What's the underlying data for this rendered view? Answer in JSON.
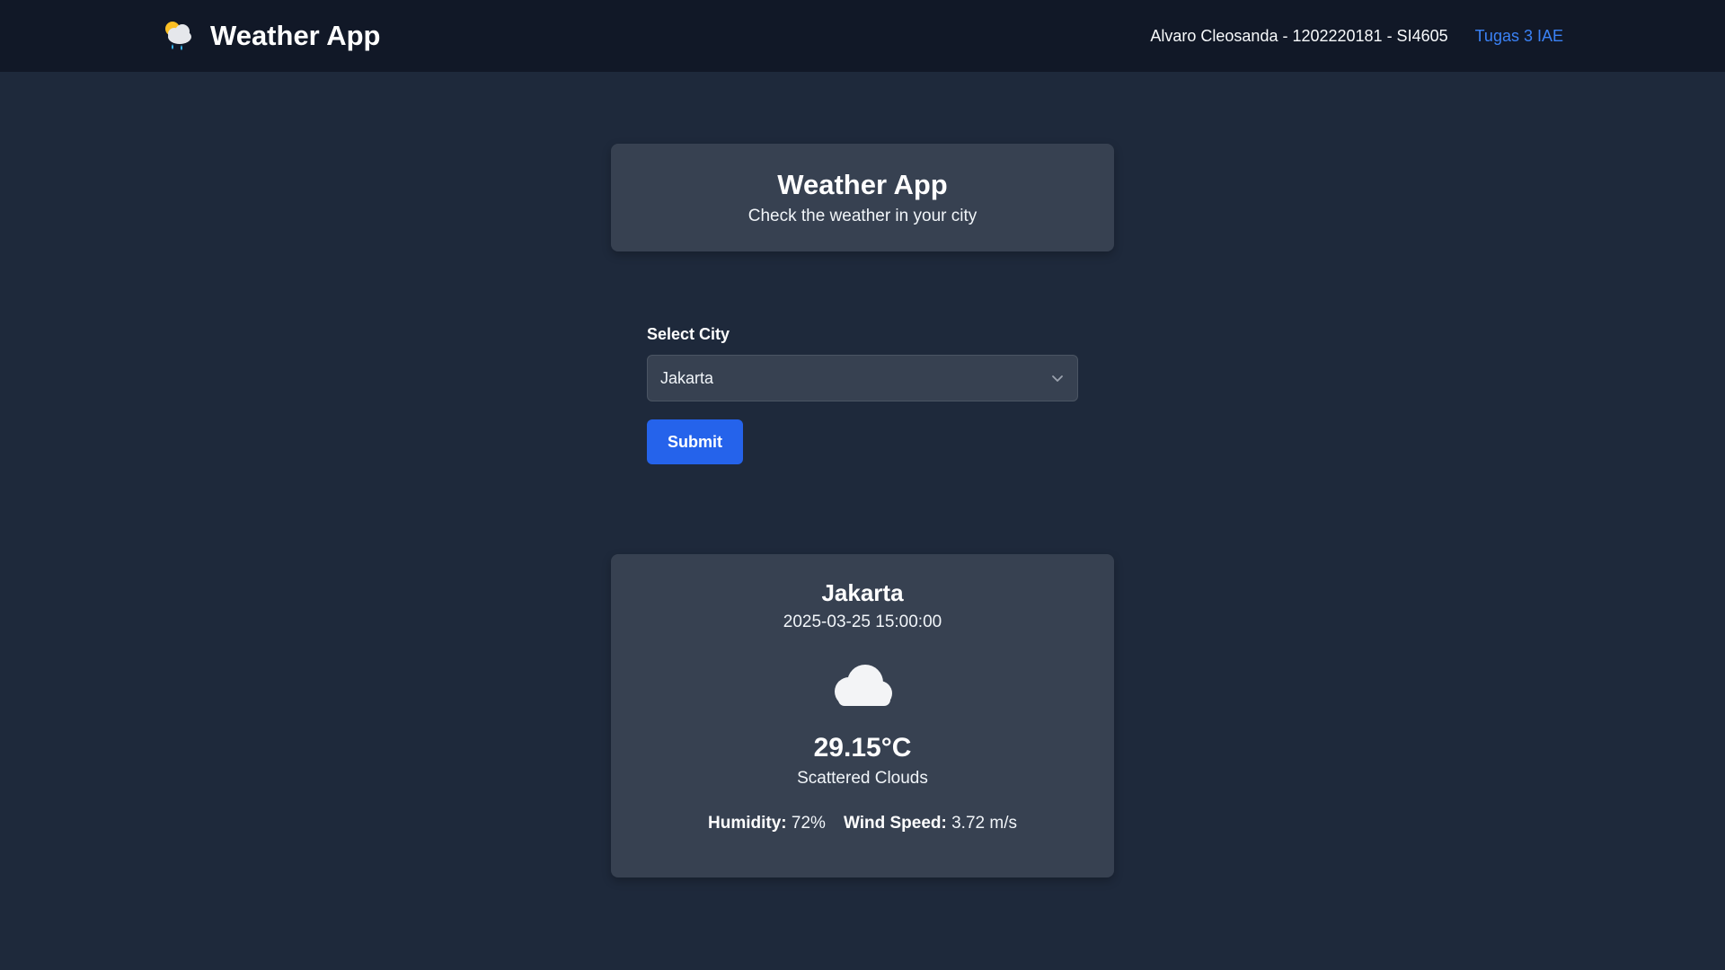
{
  "nav": {
    "title": "Weather App",
    "author": "Alvaro Cleosanda - 1202220181 - SI4605",
    "link": "Tugas 3 IAE"
  },
  "header": {
    "title": "Weather App",
    "subtitle": "Check the weather in your city"
  },
  "form": {
    "label": "Select City",
    "selected_city": "Jakarta",
    "submit_label": "Submit"
  },
  "weather": {
    "city": "Jakarta",
    "datetime": "2025-03-25 15:00:00",
    "icon": "cloud-icon",
    "temperature": "29.15°C",
    "description": "Scattered Clouds",
    "humidity_label": "Humidity:",
    "humidity_value": "72%",
    "wind_label": "Wind Speed:",
    "wind_value": "3.72 m/s"
  },
  "colors": {
    "background": "#1e293b",
    "navbar": "#111827",
    "card": "#374151",
    "accent": "#2563eb",
    "link": "#3b82f6"
  }
}
